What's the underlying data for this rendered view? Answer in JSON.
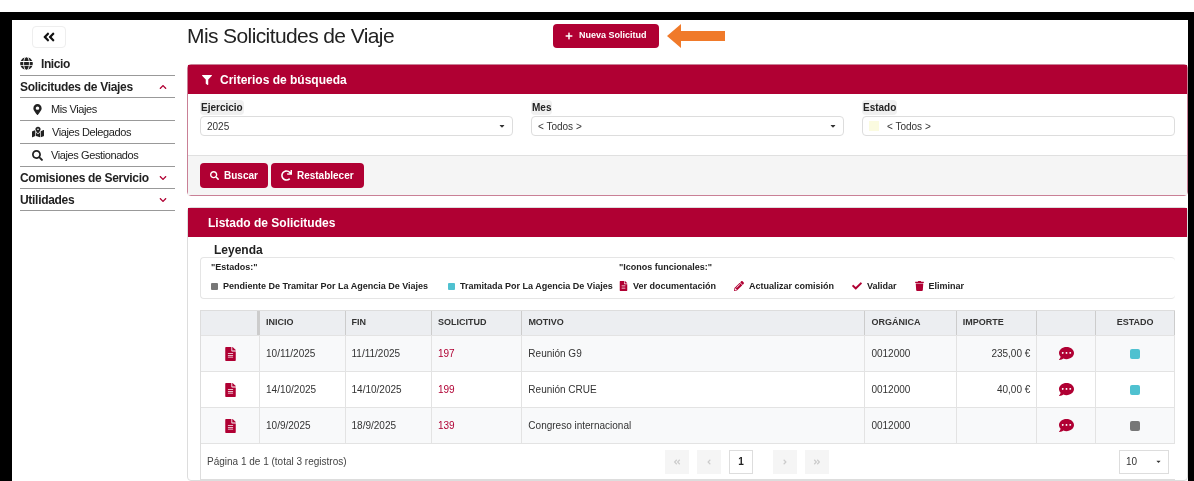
{
  "sidebar": {
    "items": [
      {
        "label": "Inicio",
        "kind": "link"
      },
      {
        "label": "Solicitudes de Viajes",
        "kind": "group",
        "expanded": true,
        "children": [
          {
            "label": "Mis Viajes",
            "kind": "pin"
          },
          {
            "label": "Viajes Delegados",
            "kind": "pins"
          },
          {
            "label": "Viajes Gestionados",
            "kind": "search"
          }
        ]
      },
      {
        "label": "Comisiones de Servicio",
        "kind": "group",
        "expanded": false
      },
      {
        "label": "Utilidades",
        "kind": "group",
        "expanded": false
      }
    ]
  },
  "page_title": "Mis Solicitudes de Viaje",
  "new_button": "Nueva Solicitud",
  "search_panel": {
    "title": "Criterios de búsqueda",
    "fields": [
      {
        "label": "Ejercicio",
        "value": "2025",
        "kind": "select"
      },
      {
        "label": "Mes",
        "value": "< Todos >",
        "kind": "select"
      },
      {
        "label": "Estado",
        "value": "< Todos >",
        "kind": "color-select"
      }
    ],
    "buttons": [
      {
        "label": "Buscar",
        "kind": "search"
      },
      {
        "label": "Restablecer",
        "kind": "reset"
      }
    ]
  },
  "list_panel": {
    "title": "Listado de Solicitudes",
    "legend": {
      "title": "Leyenda",
      "states_label": "\"Estados:\"",
      "states": [
        {
          "label": "Pendiente De Tramitar Por La Agencia De Viajes",
          "color": "#777777"
        },
        {
          "label": "Tramitada Por La Agencia De Viajes",
          "color": "#4fc1d0"
        }
      ],
      "icons_label": "\"Iconos funcionales:\"",
      "icons": [
        {
          "label": "Ver documentación",
          "kind": "file"
        },
        {
          "label": "Actualizar comisión",
          "kind": "pencil"
        },
        {
          "label": "Validar",
          "kind": "check"
        },
        {
          "label": "Eliminar",
          "kind": "trash"
        }
      ]
    },
    "table": {
      "columns": [
        "INICIO",
        "FIN",
        "SOLICITUD",
        "MOTIVO",
        "ORGÁNICA",
        "IMPORTE",
        "ESTADO"
      ],
      "rows": [
        {
          "inicio": "10/11/2025",
          "fin": "11/11/2025",
          "solicitud": "197",
          "motivo": "Reunión G9",
          "organica": "0012000",
          "importe": "235,00 €",
          "color": "#4fc1d0"
        },
        {
          "inicio": "14/10/2025",
          "fin": "14/10/2025",
          "solicitud": "199",
          "motivo": "Reunión CRUE",
          "organica": "0012000",
          "importe": "40,00 €",
          "color": "#4fc1d0"
        },
        {
          "inicio": "10/9/2025",
          "fin": "18/9/2025",
          "solicitud": "139",
          "motivo": "Congreso internacional",
          "organica": "0012000",
          "color": "#777777"
        }
      ]
    },
    "pagination": {
      "summary": "Página 1 de 1 (total 3 registros)",
      "pages": [
        {
          "label": "1",
          "selected": true
        }
      ],
      "page_size": "10"
    }
  }
}
